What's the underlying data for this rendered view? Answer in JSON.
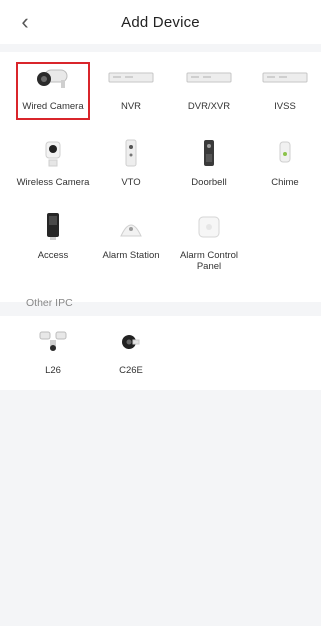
{
  "header": {
    "back_icon": "chevron-left-icon",
    "title": "Add Device"
  },
  "devices": [
    {
      "label": "Wired Camera",
      "icon": "bullet-camera-icon",
      "selected": true
    },
    {
      "label": "NVR",
      "icon": "nvr-recorder-icon"
    },
    {
      "label": "DVR/XVR",
      "icon": "dvr-recorder-icon"
    },
    {
      "label": "IVSS",
      "icon": "ivss-recorder-icon"
    },
    {
      "label": "Wireless Camera",
      "icon": "wireless-camera-icon"
    },
    {
      "label": "VTO",
      "icon": "vto-intercom-icon"
    },
    {
      "label": "Doorbell",
      "icon": "doorbell-icon"
    },
    {
      "label": "Chime",
      "icon": "chime-icon"
    },
    {
      "label": "Access",
      "icon": "access-control-icon"
    },
    {
      "label": "Alarm Station",
      "icon": "alarm-station-icon"
    },
    {
      "label": "Alarm Control Panel",
      "icon": "alarm-control-panel-icon"
    }
  ],
  "other_ipc": {
    "label": "Other IPC",
    "items": [
      {
        "label": "L26",
        "icon": "floodlight-camera-icon"
      },
      {
        "label": "C26E",
        "icon": "compact-camera-icon"
      }
    ]
  },
  "colors": {
    "accent_selected": "#d9252b",
    "background": "#f4f5f7"
  }
}
